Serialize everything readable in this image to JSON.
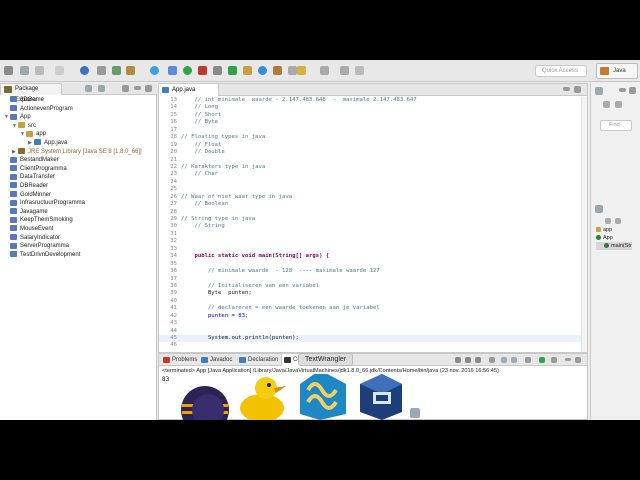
{
  "toolbar": {
    "quick_access_placeholder": "Quick Access",
    "perspective_label": "Java"
  },
  "package_explorer": {
    "tab_label": "Package Explorer",
    "items": [
      {
        "label": "3DGame",
        "indent": 0
      },
      {
        "label": "ActionevenProgram",
        "indent": 0
      },
      {
        "label": "App",
        "indent": 0,
        "expanded": true
      },
      {
        "label": "src",
        "indent": 1,
        "expanded": true
      },
      {
        "label": "app",
        "indent": 2,
        "expanded": true
      },
      {
        "label": "App.java",
        "indent": 3
      },
      {
        "label": "JRE System Library [Java SE 8 [1.8.0_66]]",
        "indent": 1
      },
      {
        "label": "BestandMaker",
        "indent": 0
      },
      {
        "label": "ClientProgramma",
        "indent": 0
      },
      {
        "label": "DataTransfer",
        "indent": 0
      },
      {
        "label": "DBReader",
        "indent": 0
      },
      {
        "label": "GoldMinner",
        "indent": 0
      },
      {
        "label": "InfrasructuurProgramma",
        "indent": 0
      },
      {
        "label": "Javagame",
        "indent": 0
      },
      {
        "label": "KeepThemSmoking",
        "indent": 0
      },
      {
        "label": "MouseEvent",
        "indent": 0
      },
      {
        "label": "SalaryIndicator",
        "indent": 0
      },
      {
        "label": "ServerProgramma",
        "indent": 0
      },
      {
        "label": "TestDrivnDevelopment",
        "indent": 0
      }
    ]
  },
  "editor": {
    "tab_label": "App.java",
    "lines": [
      {
        "n": "13",
        "t": "    // int minimale  waarde - 2.147.483.648  -  maximale 2.147.483.647"
      },
      {
        "n": "14",
        "t": "    // Long"
      },
      {
        "n": "15",
        "t": "    // Short"
      },
      {
        "n": "16",
        "t": "    // Byte"
      },
      {
        "n": "17",
        "t": ""
      },
      {
        "n": "18",
        "t": "// Floating types in java"
      },
      {
        "n": "19",
        "t": "    // Float"
      },
      {
        "n": "20",
        "t": "    // Double"
      },
      {
        "n": "21",
        "t": ""
      },
      {
        "n": "22",
        "t": "// Karakters type in java"
      },
      {
        "n": "23",
        "t": "    // Char"
      },
      {
        "n": "24",
        "t": ""
      },
      {
        "n": "25",
        "t": ""
      },
      {
        "n": "26",
        "t": "// Waar of niet waar type in java"
      },
      {
        "n": "27",
        "t": "    // Boolean"
      },
      {
        "n": "28",
        "t": ""
      },
      {
        "n": "29",
        "t": "// String type in java"
      },
      {
        "n": "30",
        "t": "    // String"
      },
      {
        "n": "31",
        "t": ""
      },
      {
        "n": "32",
        "t": ""
      },
      {
        "n": "33",
        "t": ""
      },
      {
        "n": "34",
        "t": "    public static void main(String[] args) {"
      },
      {
        "n": "35",
        "t": ""
      },
      {
        "n": "36",
        "t": "        // minimale waarde  - 128  ---- maximale waarde 127"
      },
      {
        "n": "37",
        "t": ""
      },
      {
        "n": "38",
        "t": "        // Initialiseren van een variabel"
      },
      {
        "n": "39",
        "t": "        Byte  punten;"
      },
      {
        "n": "40",
        "t": ""
      },
      {
        "n": "41",
        "t": "        // declareren = een waarde toekenen aan je variabel"
      },
      {
        "n": "42",
        "t": "        punten = 83;"
      },
      {
        "n": "43",
        "t": ""
      },
      {
        "n": "44",
        "t": ""
      },
      {
        "n": "45",
        "t": "        System.out.println(punten);"
      },
      {
        "n": "46",
        "t": ""
      }
    ]
  },
  "outline": {
    "find_placeholder": "Find",
    "items": [
      "app",
      "App",
      "main(Str"
    ]
  },
  "console": {
    "tabs": [
      "Problems",
      "Javadoc",
      "Declaration",
      "Co"
    ],
    "status_line": "<terminated> App [Java Application] /Library/Java/JavaVirtualMachines/jdk1.8.0_66.jdk/Contents/Home/bin/java (23 nov. 2016 16:56:45)",
    "output": "83"
  },
  "dock": {
    "tooltip": "TextWrangler",
    "apps": [
      "eclipse-icon",
      "cyberduck-icon",
      "textwrangler-icon",
      "virtualbox-icon"
    ]
  },
  "colors": {
    "comment": "#4a7d8a",
    "keyword": "#7f0055",
    "highlight": "#e2d8e8"
  }
}
